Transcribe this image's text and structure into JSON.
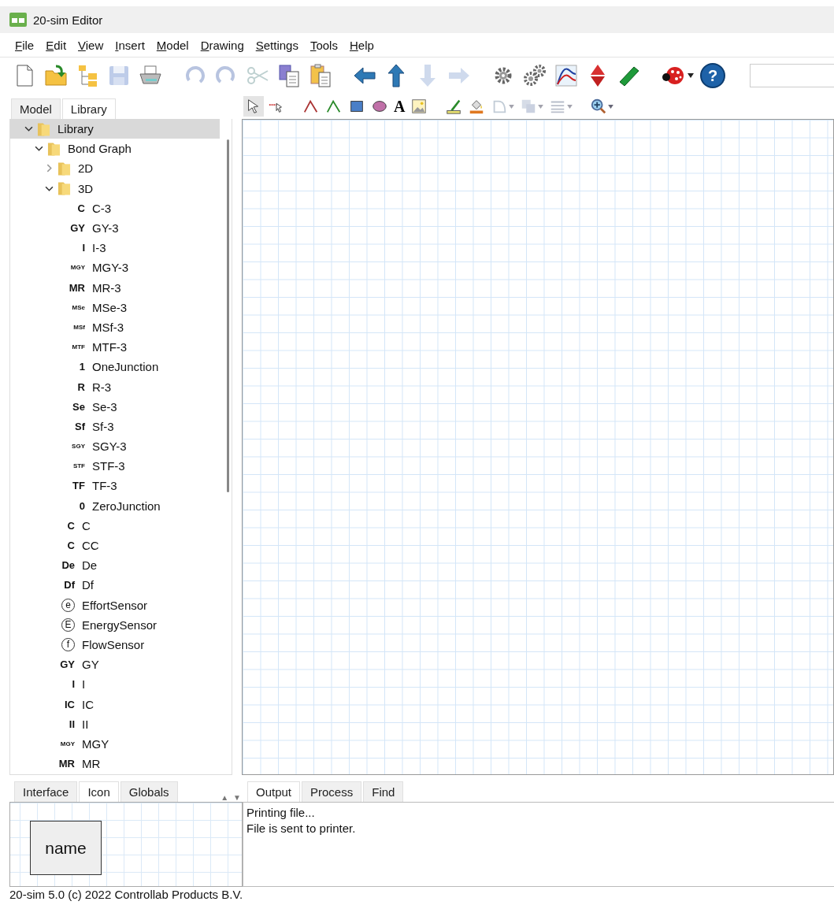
{
  "window": {
    "title": "20-sim Editor"
  },
  "menu": [
    "File",
    "Edit",
    "View",
    "Insert",
    "Model",
    "Drawing",
    "Settings",
    "Tools",
    "Help"
  ],
  "toolbar": {
    "groups": [
      [
        {
          "kind": "new",
          "disabled": false
        },
        {
          "kind": "open",
          "disabled": false
        },
        {
          "kind": "tree",
          "disabled": false
        },
        {
          "kind": "save",
          "disabled": true
        },
        {
          "kind": "print",
          "disabled": false
        }
      ],
      [
        {
          "kind": "undo",
          "disabled": true
        },
        {
          "kind": "redo",
          "disabled": true
        },
        {
          "kind": "cut",
          "disabled": true
        },
        {
          "kind": "copy",
          "disabled": false
        },
        {
          "kind": "paste",
          "disabled": false
        }
      ],
      [
        {
          "kind": "left",
          "disabled": false
        },
        {
          "kind": "up",
          "disabled": false
        },
        {
          "kind": "down",
          "disabled": true
        },
        {
          "kind": "right",
          "disabled": true
        }
      ],
      [
        {
          "kind": "gear",
          "disabled": false
        },
        {
          "kind": "gears",
          "disabled": false
        },
        {
          "kind": "plot",
          "disabled": false
        },
        {
          "kind": "diamond",
          "disabled": false
        },
        {
          "kind": "ruler",
          "disabled": false
        }
      ],
      [
        {
          "kind": "bug",
          "disabled": false,
          "dropdown": true
        },
        {
          "kind": "help",
          "disabled": false,
          "label": "?"
        }
      ]
    ]
  },
  "left_tabs": [
    {
      "label": "Model",
      "selected": false
    },
    {
      "label": "Library",
      "selected": true
    }
  ],
  "drawing_toolbar": {
    "groups": [
      [
        {
          "kind": "pointer",
          "selected": true,
          "disabled": false
        },
        {
          "kind": "connector",
          "selected": false,
          "disabled": false
        }
      ],
      [
        {
          "kind": "bond",
          "selected": false,
          "disabled": false
        },
        {
          "kind": "signal",
          "selected": false,
          "disabled": false
        },
        {
          "kind": "rect",
          "selected": false,
          "disabled": false
        },
        {
          "kind": "ellipse",
          "selected": false,
          "disabled": false
        },
        {
          "kind": "text",
          "label": "A",
          "selected": false,
          "disabled": false
        },
        {
          "kind": "image",
          "selected": false,
          "disabled": false
        }
      ],
      [
        {
          "kind": "pen",
          "selected": false,
          "disabled": false
        },
        {
          "kind": "fill",
          "selected": false,
          "disabled": false
        },
        {
          "kind": "rotate",
          "selected": false,
          "disabled": true,
          "dropdown": true
        },
        {
          "kind": "align",
          "selected": false,
          "disabled": true,
          "dropdown": true
        },
        {
          "kind": "lines",
          "selected": false,
          "disabled": true,
          "dropdown": true
        }
      ],
      [
        {
          "kind": "zoom",
          "selected": false,
          "disabled": false,
          "dropdown": true
        }
      ]
    ]
  },
  "tree": [
    {
      "label": "Library",
      "kind": "folder",
      "expanded": true,
      "selected": true,
      "children": [
        {
          "label": "Bond Graph",
          "kind": "folder",
          "expanded": true,
          "selected": false,
          "children": [
            {
              "label": "2D",
              "kind": "folder",
              "expanded": false,
              "selected": false
            },
            {
              "label": "3D",
              "kind": "folder",
              "expanded": true,
              "selected": false,
              "children": [
                {
                  "label": "C-3",
                  "kind": "letter",
                  "badge": "C",
                  "selected": false
                },
                {
                  "label": "GY-3",
                  "kind": "letter",
                  "badge": "GY",
                  "selected": false
                },
                {
                  "label": "I-3",
                  "kind": "letter",
                  "badge": "I",
                  "selected": false
                },
                {
                  "label": "MGY-3",
                  "kind": "letter",
                  "badge": "MGY",
                  "selected": false
                },
                {
                  "label": "MR-3",
                  "kind": "letter",
                  "badge": "MR",
                  "selected": false
                },
                {
                  "label": "MSe-3",
                  "kind": "letter",
                  "badge": "MSe",
                  "selected": false
                },
                {
                  "label": "MSf-3",
                  "kind": "letter",
                  "badge": "MSf",
                  "selected": false
                },
                {
                  "label": "MTF-3",
                  "kind": "letter",
                  "badge": "MTF",
                  "selected": false
                },
                {
                  "label": "OneJunction",
                  "kind": "letter",
                  "badge": "1",
                  "selected": false
                },
                {
                  "label": "R-3",
                  "kind": "letter",
                  "badge": "R",
                  "selected": false
                },
                {
                  "label": "Se-3",
                  "kind": "letter",
                  "badge": "Se",
                  "selected": false
                },
                {
                  "label": "Sf-3",
                  "kind": "letter",
                  "badge": "Sf",
                  "selected": false
                },
                {
                  "label": "SGY-3",
                  "kind": "letter",
                  "badge": "SGY",
                  "selected": false
                },
                {
                  "label": "STF-3",
                  "kind": "letter",
                  "badge": "STF",
                  "selected": false
                },
                {
                  "label": "TF-3",
                  "kind": "letter",
                  "badge": "TF",
                  "selected": false
                },
                {
                  "label": "ZeroJunction",
                  "kind": "letter",
                  "badge": "0",
                  "selected": false
                }
              ]
            },
            {
              "label": "C",
              "kind": "letter",
              "badge": "C",
              "selected": false
            },
            {
              "label": "CC",
              "kind": "letter",
              "badge": "C",
              "selected": false
            },
            {
              "label": "De",
              "kind": "letter",
              "badge": "De",
              "selected": false
            },
            {
              "label": "Df",
              "kind": "letter",
              "badge": "Df",
              "selected": false
            },
            {
              "label": "EffortSensor",
              "kind": "circled",
              "badge": "e",
              "selected": false
            },
            {
              "label": "EnergySensor",
              "kind": "circled",
              "badge": "E",
              "selected": false
            },
            {
              "label": "FlowSensor",
              "kind": "circled",
              "badge": "f",
              "selected": false
            },
            {
              "label": "GY",
              "kind": "letter",
              "badge": "GY",
              "selected": false
            },
            {
              "label": "I",
              "kind": "letter",
              "badge": "I",
              "selected": false
            },
            {
              "label": "IC",
              "kind": "letter",
              "badge": "IC",
              "selected": false
            },
            {
              "label": "II",
              "kind": "letter",
              "badge": "II",
              "selected": false
            },
            {
              "label": "MGY",
              "kind": "letter",
              "badge": "MGY",
              "selected": false
            },
            {
              "label": "MR",
              "kind": "letter",
              "badge": "MR",
              "selected": false
            }
          ]
        }
      ]
    }
  ],
  "icon_panel": {
    "tabs": [
      {
        "label": "Interface",
        "selected": false
      },
      {
        "label": "Icon",
        "selected": true
      },
      {
        "label": "Globals",
        "selected": false
      }
    ],
    "scroll_arrows": [
      "▲",
      "▼"
    ],
    "block_label": "name"
  },
  "output_panel": {
    "tabs": [
      {
        "label": "Output",
        "selected": true
      },
      {
        "label": "Process",
        "selected": false
      },
      {
        "label": "Find",
        "selected": false
      }
    ],
    "lines": [
      "Printing file...",
      "File is sent to printer."
    ]
  },
  "status_bar": "20-sim 5.0 (c) 2022 Controllab Products B.V."
}
